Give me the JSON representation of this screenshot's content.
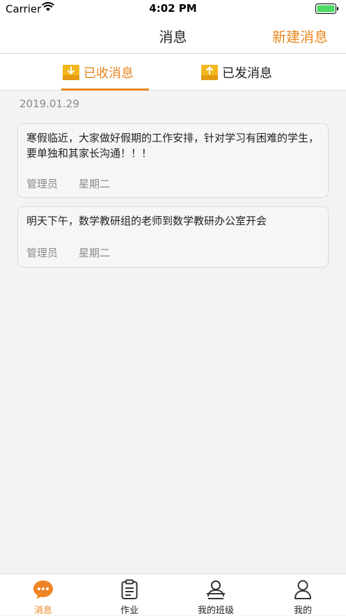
{
  "status_bar": {
    "carrier": "Carrier",
    "time": "4:02 PM"
  },
  "nav": {
    "title": "消息",
    "new_message": "新建消息"
  },
  "tabs": [
    {
      "label": "已收消息",
      "icon": "inbox-download-icon",
      "active": true
    },
    {
      "label": "已发消息",
      "icon": "outbox-upload-icon",
      "active": false
    }
  ],
  "date_group": "2019.01.29",
  "messages": [
    {
      "text": "寒假临近，大家做好假期的工作安排，针对学习有困难的学生，要单独和其家长沟通！！！",
      "sender": "管理员",
      "day": "星期二"
    },
    {
      "text": "明天下午，数学教研组的老师到数学教研办公室开会",
      "sender": "管理员",
      "day": "星期二"
    }
  ],
  "tab_bar": [
    {
      "label": "消息",
      "icon": "chat-bubble-icon",
      "active": true
    },
    {
      "label": "作业",
      "icon": "clipboard-icon",
      "active": false
    },
    {
      "label": "我的班级",
      "icon": "class-person-icon",
      "active": false
    },
    {
      "label": "我的",
      "icon": "profile-icon",
      "active": false
    }
  ],
  "colors": {
    "accent": "#e8861f",
    "tab_icon": "#f2b71c",
    "background": "#f3f3f3"
  }
}
